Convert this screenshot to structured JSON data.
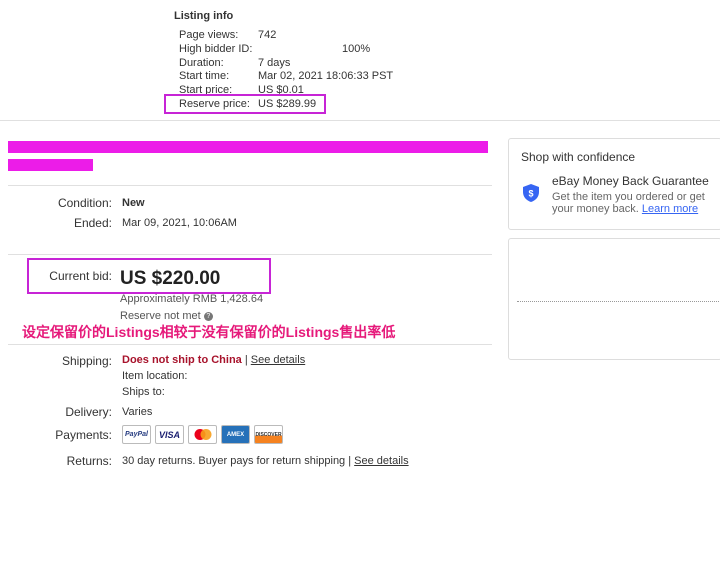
{
  "listing_info": {
    "title": "Listing info",
    "rows": [
      {
        "label": "Page views:",
        "value": "742"
      },
      {
        "label": "High bidder ID:",
        "value": "100%"
      },
      {
        "label": "Duration:",
        "value": "7 days"
      },
      {
        "label": "Start time:",
        "value": "Mar 02, 2021 18:06:33 PST"
      },
      {
        "label": "Start price:",
        "value": "US $0.01"
      },
      {
        "label": "Reserve price:",
        "value": "US $289.99"
      }
    ]
  },
  "item": {
    "condition_label": "Condition:",
    "condition_value": "New",
    "ended_label": "Ended:",
    "ended_value": "Mar 09, 2021, 10:06AM"
  },
  "bid": {
    "label": "Current bid:",
    "price": "US $220.00",
    "approx": "Approximately RMB 1,428.64",
    "reserve_status": "Reserve not met"
  },
  "annotation": "设定保留价的Listings相较于没有保留价的Listings售出率低",
  "shipping": {
    "label": "Shipping:",
    "status": "Does not ship to China",
    "separator": "|",
    "details_link": "See details",
    "item_location_label": "Item location:",
    "ships_to_label": "Ships to:"
  },
  "delivery": {
    "label": "Delivery:",
    "value": "Varies"
  },
  "payments": {
    "label": "Payments:",
    "methods": [
      "PayPal",
      "VISA",
      "",
      "AMEX",
      "DISCOVER"
    ]
  },
  "returns": {
    "label": "Returns:",
    "value": "30 day returns. Buyer pays for return shipping |",
    "details_link": "See details"
  },
  "confidence": {
    "title": "Shop with confidence",
    "guarantee_title": "eBay Money Back Guarantee",
    "guarantee_text_1": "Get the item you ordered or get",
    "guarantee_text_2": "your money back.",
    "learn_more": "Learn more"
  },
  "colors": {
    "highlight": "#c724d6",
    "redaction": "#ec1ce8",
    "annotation": "#e6197a",
    "warning": "#a8132c",
    "shield": "#3665f3"
  }
}
